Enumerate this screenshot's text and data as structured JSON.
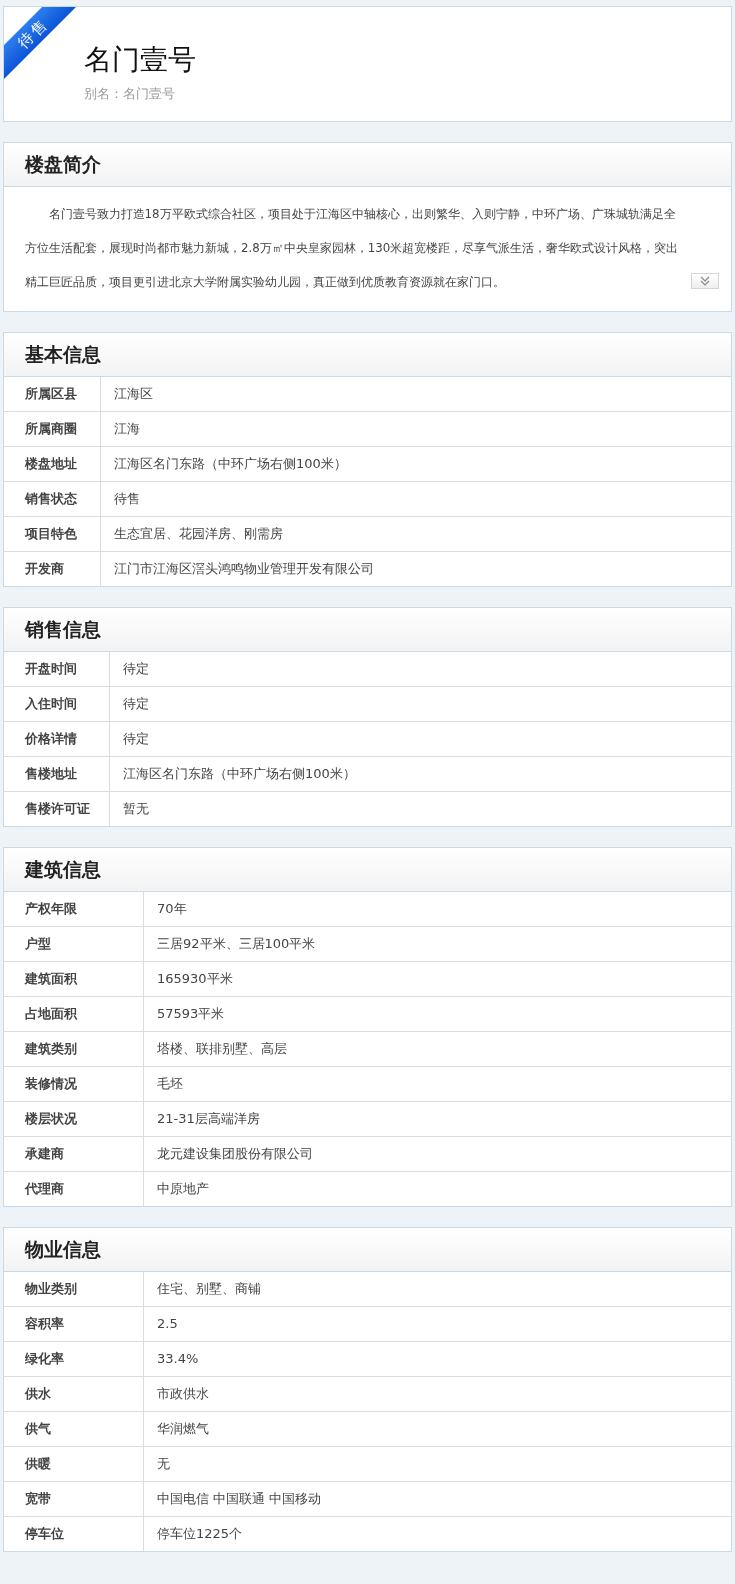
{
  "header": {
    "badge": "待售",
    "title": "名门壹号",
    "alias": "别名：名门壹号"
  },
  "intro": {
    "title": "楼盘简介",
    "text": "名门壹号致力打造18万平欧式综合社区，项目处于江海区中轴核心，出则繁华、入则宁静，中环广场、广珠城轨满足全方位生活配套，展现时尚都市魅力新城，2.8万㎡中央皇家园林，130米超宽楼距，尽享气派生活，奢华欧式设计风格，突出精工巨匠品质，项目更引进北京大学附属实验幼儿园，真正做到优质教育资源就在家门口。",
    "expanded": false
  },
  "sections": [
    {
      "title": "基本信息",
      "rows": [
        {
          "label": "所属区县",
          "value": "江海区"
        },
        {
          "label": "所属商圈",
          "value": "江海"
        },
        {
          "label": "楼盘地址",
          "value": "江海区名门东路（中环广场右侧100米）"
        },
        {
          "label": "销售状态",
          "value": "待售"
        },
        {
          "label": "项目特色",
          "value": "生态宜居、花园洋房、刚需房"
        },
        {
          "label": "开发商",
          "value": "江门市江海区滘头鸿鸣物业管理开发有限公司"
        }
      ]
    },
    {
      "title": "销售信息",
      "rows": [
        {
          "label": "开盘时间",
          "value": "待定"
        },
        {
          "label": "入住时间",
          "value": "待定"
        },
        {
          "label": "价格详情",
          "value": "待定"
        },
        {
          "label": "售楼地址",
          "value": "江海区名门东路（中环广场右侧100米）"
        },
        {
          "label": "售楼许可证",
          "value": "暂无"
        }
      ]
    },
    {
      "title": "建筑信息",
      "rows": [
        {
          "label": "产权年限",
          "value": "70年"
        },
        {
          "label": "户型",
          "value": "三居92平米、三居100平米"
        },
        {
          "label": "建筑面积",
          "value": "165930平米"
        },
        {
          "label": "占地面积",
          "value": "57593平米"
        },
        {
          "label": "建筑类别",
          "value": "塔楼、联排别墅、高层"
        },
        {
          "label": "装修情况",
          "value": "毛坯"
        },
        {
          "label": "楼层状况",
          "value": "21-31层高端洋房"
        },
        {
          "label": "承建商",
          "value": "龙元建设集团股份有限公司"
        },
        {
          "label": "代理商",
          "value": "中原地产"
        }
      ]
    },
    {
      "title": "物业信息",
      "rows": [
        {
          "label": "物业类别",
          "value": "住宅、别墅、商铺"
        },
        {
          "label": "容积率",
          "value": "2.5"
        },
        {
          "label": "绿化率",
          "value": "33.4%"
        },
        {
          "label": "供水",
          "value": "市政供水"
        },
        {
          "label": "供气",
          "value": "华润燃气"
        },
        {
          "label": "供暖",
          "value": "无"
        },
        {
          "label": "宽带",
          "value": "中国电信 中国联通 中国移动"
        },
        {
          "label": "停车位",
          "value": "停车位1225个"
        }
      ]
    }
  ]
}
